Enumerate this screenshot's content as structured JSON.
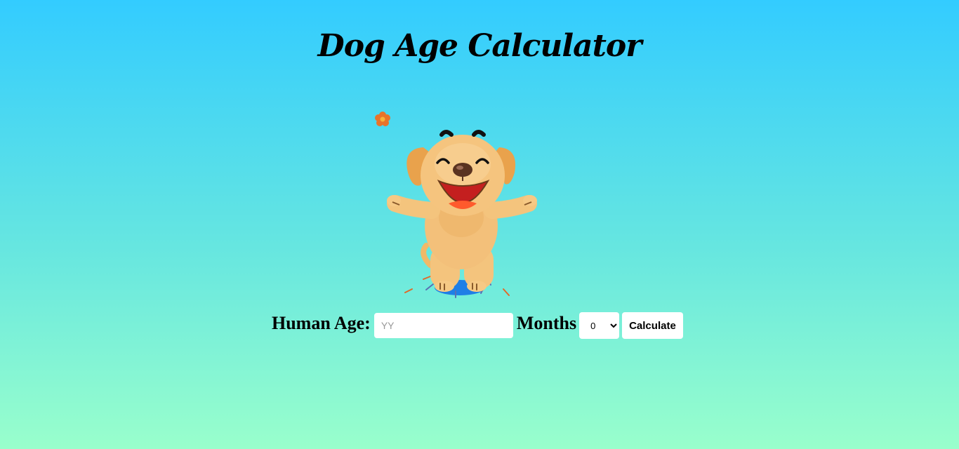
{
  "header": {
    "title": "Dog Age Calculator"
  },
  "illustration": {
    "icon": "happy-dog-illustration",
    "decoration_icon": "flower-icon"
  },
  "form": {
    "human_age_label": "Human Age:",
    "years_placeholder": "YY",
    "years_value": "",
    "months_label": "Months",
    "months_selected": "0",
    "calculate_label": "Calculate"
  },
  "colors": {
    "background_top": "#33ccff",
    "background_bottom": "#99ffcc"
  }
}
